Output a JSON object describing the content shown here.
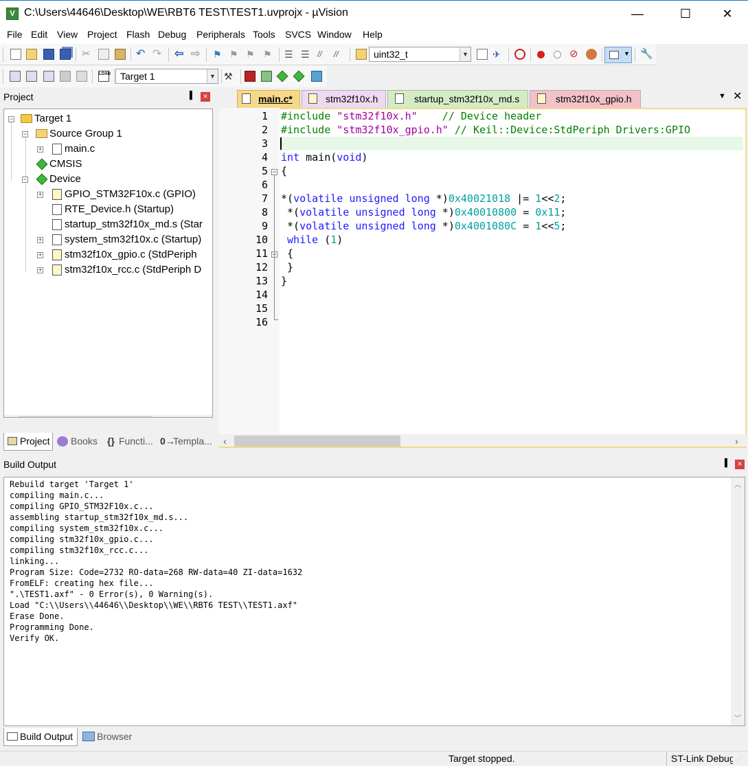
{
  "window": {
    "title": "C:\\Users\\44646\\Desktop\\WE\\RBT6 TEST\\TEST1.uvprojx - µVision",
    "app_icon_letter": "V",
    "controls": {
      "minimize": "—",
      "maximize": "☐",
      "close": "✕"
    }
  },
  "menu": [
    "File",
    "Edit",
    "View",
    "Project",
    "Flash",
    "Debug",
    "Peripherals",
    "Tools",
    "SVCS",
    "Window",
    "Help"
  ],
  "toolbar": {
    "find_combo_value": "uint32_t",
    "target_combo_value": "Target 1"
  },
  "project_panel": {
    "title": "Project",
    "pin": "📌",
    "close": "×",
    "tree": {
      "target": "Target 1",
      "source_group": "Source Group 1",
      "main_file": "main.c",
      "cmsis": "CMSIS",
      "device": "Device",
      "device_files": [
        "GPIO_STM32F10x.c (GPIO)",
        "RTE_Device.h (Startup)",
        "startup_stm32f10x_md.s (Star",
        "system_stm32f10x.c (Startup)",
        "stm32f10x_gpio.c (StdPeriph",
        "stm32f10x_rcc.c (StdPeriph D"
      ]
    },
    "tabs": [
      "Project",
      "Books",
      "Functi...",
      "Templa..."
    ]
  },
  "editor": {
    "tabs": [
      "main.c*",
      "stm32f10x.h",
      "startup_stm32f10x_md.s",
      "stm32f10x_gpio.h"
    ],
    "tab_colors": [
      "#f5d98a",
      "#eed9f2",
      "#d4ecc4",
      "#f2c2c8"
    ],
    "line_numbers": [
      "1",
      "2",
      "3",
      "4",
      "5",
      "6",
      "7",
      "8",
      "9",
      "10",
      "11",
      "12",
      "13",
      "14",
      "15",
      "16"
    ],
    "code": {
      "l1_pp": "#include ",
      "l1_str": "\"stm32f10x.h\"",
      "l1_cmt": "    // Device header",
      "l2_pp": "#include ",
      "l2_str": "\"stm32f10x_gpio.h\"",
      "l2_cmt": " // Keil::Device:StdPeriph Drivers:GPIO",
      "l4_kw": "int",
      "l4_mid": " main(",
      "l4_kw2": "void",
      "l4_end": ")",
      "l5": "{",
      "l7_a": "*(",
      "l7_kw": "volatile unsigned long",
      "l7_b": " *)",
      "l7_addr": "0x40021018",
      "l7_op": " |= ",
      "l7_n1": "1",
      "l7_shift": "<<",
      "l7_n2": "2",
      "l7_end": ";",
      "l8_a": " *(",
      "l8_kw": "volatile unsigned long",
      "l8_b": " *)",
      "l8_addr": "0x40010800",
      "l8_op": " = ",
      "l8_val": "0x11",
      "l8_end": ";",
      "l9_a": " *(",
      "l9_kw": "volatile unsigned long",
      "l9_b": " *)",
      "l9_addr": "0x4001080C",
      "l9_op": " = ",
      "l9_n1": "1",
      "l9_shift": "<<",
      "l9_n2": "5",
      "l9_end": ";",
      "l10_kw": " while",
      "l10_a": " (",
      "l10_n": "1",
      "l10_end": ")",
      "l11": " {",
      "l12": " }",
      "l13": "}"
    }
  },
  "build_output": {
    "title": "Build Output",
    "lines": [
      "Rebuild target 'Target 1'",
      "compiling main.c...",
      "compiling GPIO_STM32F10x.c...",
      "assembling startup_stm32f10x_md.s...",
      "compiling system_stm32f10x.c...",
      "compiling stm32f10x_gpio.c...",
      "compiling stm32f10x_rcc.c...",
      "linking...",
      "Program Size: Code=2732 RO-data=268 RW-data=40 ZI-data=1632",
      "FromELF: creating hex file...",
      "\".\\TEST1.axf\" - 0 Error(s), 0 Warning(s).",
      "Load \"C:\\\\Users\\\\44646\\\\Desktop\\\\WE\\\\RBT6 TEST\\\\TEST1.axf\"",
      "Erase Done.",
      "Programming Done.",
      "Verify OK."
    ],
    "tabs": [
      "Build Output",
      "Browser"
    ]
  },
  "status": {
    "message": "Target stopped.",
    "debugger": "ST-Link Debug"
  },
  "colors": {
    "titlebar_accent": "#1874d2",
    "current_line_bg": "#e8f8e8",
    "keyword": "#1a1aff",
    "string": "#a000a0",
    "comment": "#008000",
    "number": "#00a0a0"
  }
}
